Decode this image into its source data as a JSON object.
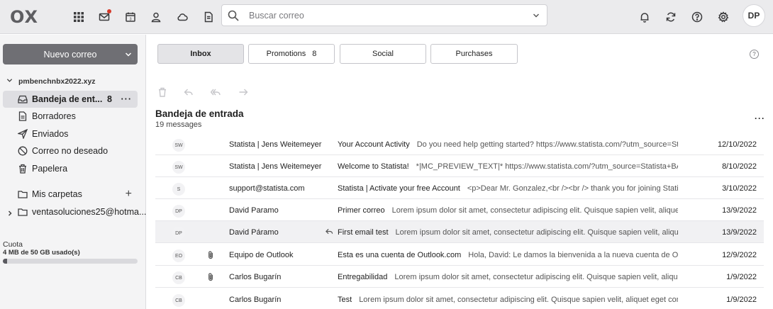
{
  "topbar": {
    "logo": "OX",
    "search_placeholder": "Buscar correo",
    "avatar_initials": "DP",
    "accent_notification": "#d43a2b"
  },
  "sidebar": {
    "compose_label": "Nuevo correo",
    "account": "pmbenchnbx2022.xyz",
    "folders": [
      {
        "label": "Bandeja de ent...",
        "count": "8",
        "more": "···"
      },
      {
        "label": "Borradores"
      },
      {
        "label": "Enviados"
      },
      {
        "label": "Correo no deseado"
      },
      {
        "label": "Papelera"
      }
    ],
    "my_folders": "Mis carpetas",
    "my_folders_add": "+",
    "external_account": "ventasoluciones25@hotma...",
    "quota_label": "Cuota",
    "quota_value": "4 MB de 50 GB usado(s)",
    "quota_fraction": 0.03
  },
  "tabs": [
    {
      "label": "Inbox",
      "count": ""
    },
    {
      "label": "Promotions",
      "count": "8"
    },
    {
      "label": "Social",
      "count": ""
    },
    {
      "label": "Purchases",
      "count": ""
    }
  ],
  "help_label": "?",
  "list": {
    "title": "Bandeja de entrada",
    "count": "19 messages",
    "more": "···",
    "messages": [
      {
        "initials": "SW",
        "from": "Statista | Jens Weitemeyer",
        "subject": "Your Account Activity",
        "preview": "Do you need help getting started? https://www.statista.com/?utm_source=St...",
        "date": "12/10/2022",
        "attachment": false,
        "replied": false
      },
      {
        "initials": "SW",
        "from": "Statista | Jens Weitemeyer",
        "subject": "Welcome to Statista!",
        "preview": "*|MC_PREVIEW_TEXT|* https://www.statista.com/?utm_source=Statista+BA%...",
        "date": "8/10/2022",
        "attachment": false,
        "replied": false
      },
      {
        "initials": "S",
        "from": "support@statista.com",
        "subject": "Statista | Activate your free Account",
        "preview": "<p>Dear Mr. Gonzalez,<br /><br /> thank you for joining Statis...",
        "date": "3/10/2022",
        "attachment": false,
        "replied": false
      },
      {
        "initials": "DP",
        "from": "David Paramo",
        "subject": "Primer correo",
        "preview": "Lorem ipsum dolor sit amet, consectetur adipiscing elit. Quisque sapien velit, aliquet ...",
        "date": "13/9/2022",
        "attachment": false,
        "replied": false
      },
      {
        "initials": "DP",
        "from": "David Páramo",
        "subject": "First email test",
        "preview": "Lorem ipsum dolor sit amet, consectetur adipiscing elit. Quisque sapien velit, alique...",
        "date": "13/9/2022",
        "attachment": false,
        "replied": true
      },
      {
        "initials": "EO",
        "from": "Equipo de Outlook",
        "subject": "Esta es una cuenta de Outlook.com",
        "preview": "Hola, David:  Le damos la bienvenida a la nueva cuenta de Outl...",
        "date": "12/9/2022",
        "attachment": true,
        "replied": false
      },
      {
        "initials": "CB",
        "from": "Carlos Bugarín",
        "subject": "Entregabilidad",
        "preview": "Lorem ipsum dolor sit amet, consectetur adipiscing elit. Quisque sapien velit, alique...",
        "date": "1/9/2022",
        "attachment": true,
        "replied": false
      },
      {
        "initials": "CB",
        "from": "Carlos Bugarín",
        "subject": "Test",
        "preview": "Lorem ipsum dolor sit amet, consectetur adipiscing elit. Quisque sapien velit, aliquet eget commo...",
        "date": "1/9/2022",
        "attachment": false,
        "replied": false
      }
    ]
  }
}
